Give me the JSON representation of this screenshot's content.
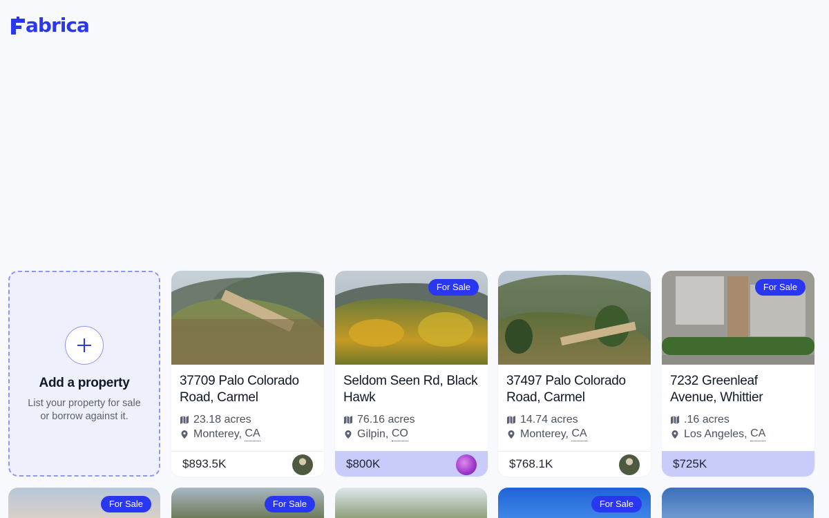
{
  "brand": {
    "name": "abrica",
    "accent": "#2a37f0"
  },
  "add_card": {
    "title": "Add a property",
    "subtitle": "List your property for sale or borrow against it."
  },
  "properties": [
    {
      "address": "37709 Palo Colorado Road, Carmel",
      "acres": "23.18 acres",
      "county": "Monterey, ",
      "state": "CA",
      "price": "$893.5K",
      "for_sale": false,
      "badge": "",
      "highlight": false
    },
    {
      "address": "Seldom Seen Rd, Black Hawk",
      "acres": "76.16 acres",
      "county": "Gilpin, ",
      "state": "CO",
      "price": "$800K",
      "for_sale": true,
      "badge": "For Sale",
      "highlight": true
    },
    {
      "address": "37497 Palo Colorado Road, Carmel",
      "acres": "14.74 acres",
      "county": "Monterey, ",
      "state": "CA",
      "price": "$768.1K",
      "for_sale": false,
      "badge": "",
      "highlight": false
    },
    {
      "address": "7232 Greenleaf Avenue, Whittier",
      "acres": ".16 acres",
      "county": "Los Angeles, ",
      "state": "CA",
      "price": "$725K",
      "for_sale": true,
      "badge": "For Sale",
      "highlight": true
    }
  ],
  "row2_badges": [
    "For Sale",
    "For Sale",
    "",
    "For Sale",
    ""
  ]
}
